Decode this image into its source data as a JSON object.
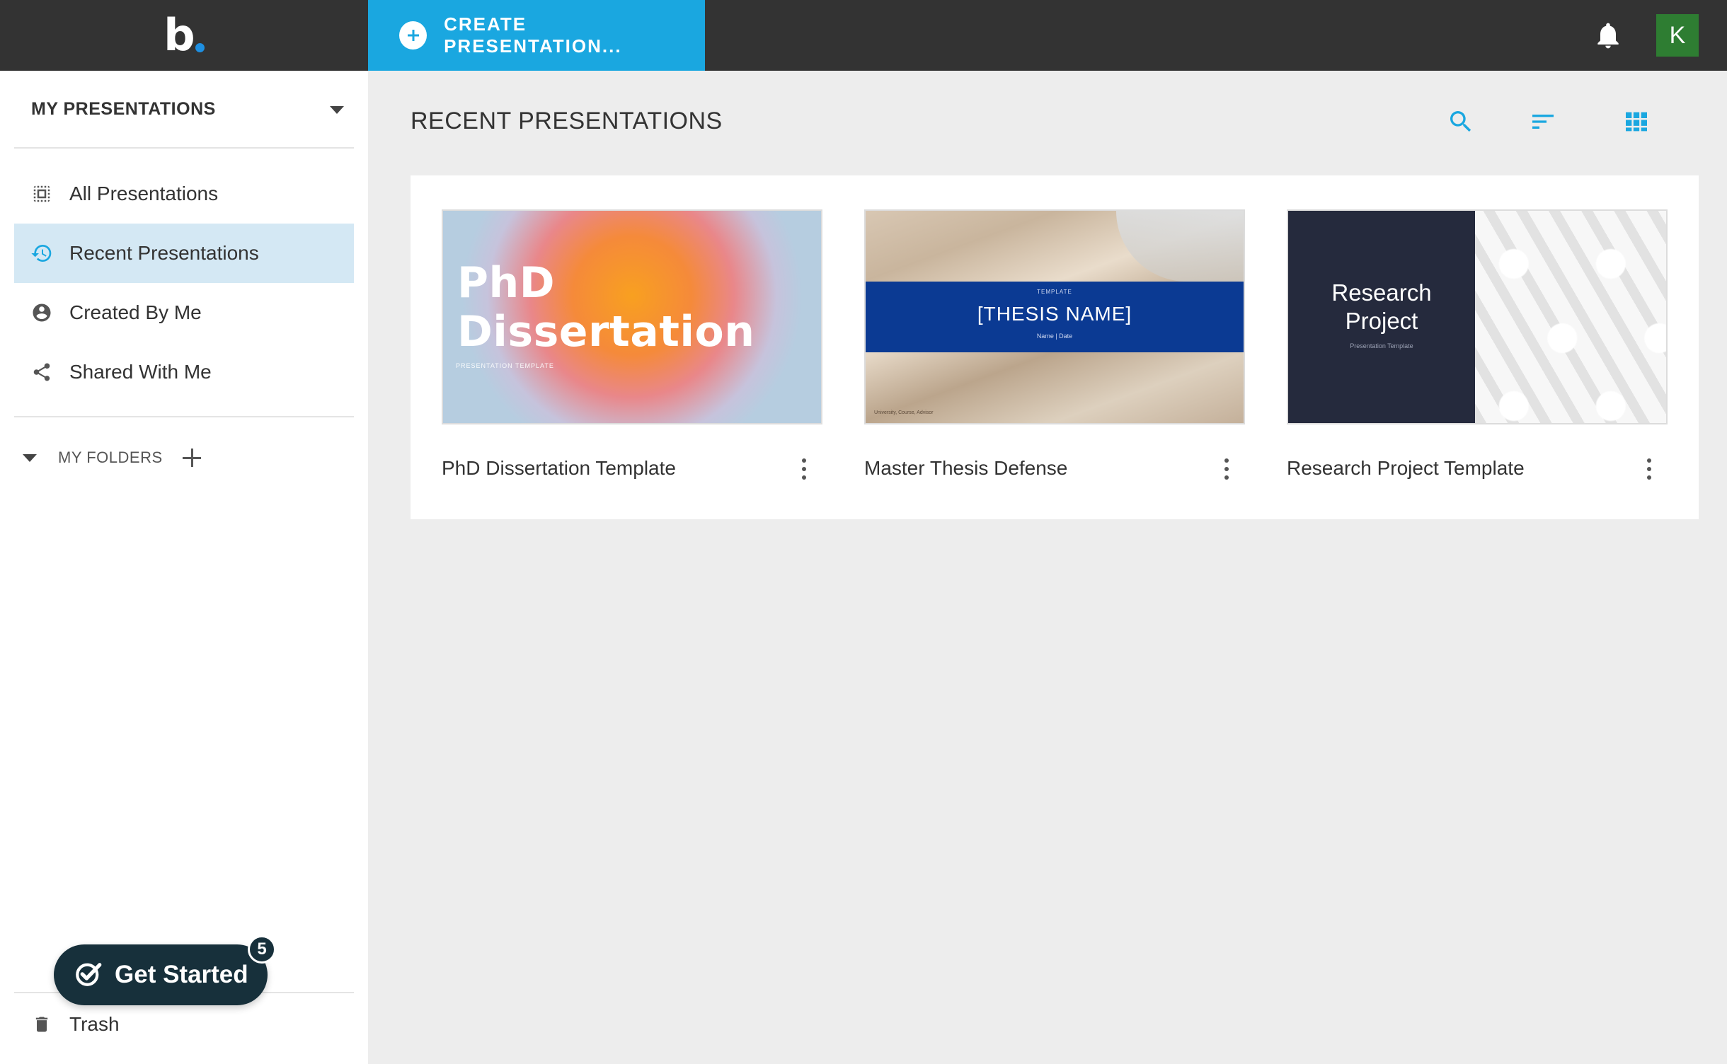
{
  "topbar": {
    "logo_letter": "b",
    "create_label": "CREATE PRESENTATION...",
    "avatar_initial": "K",
    "colors": {
      "bar": "#333333",
      "accent": "#1aa7e0",
      "avatar": "#2e7d32"
    }
  },
  "sidebar": {
    "header": "MY PRESENTATIONS",
    "items": [
      {
        "label": "All Presentations",
        "icon": "grid-select-icon"
      },
      {
        "label": "Recent Presentations",
        "icon": "history-icon",
        "active": true
      },
      {
        "label": "Created By Me",
        "icon": "person-icon"
      },
      {
        "label": "Shared With Me",
        "icon": "share-icon"
      }
    ],
    "folders_label": "MY FOLDERS",
    "trash_label": "Trash"
  },
  "get_started": {
    "label": "Get Started",
    "badge": "5"
  },
  "main": {
    "title": "RECENT PRESENTATIONS",
    "tools": [
      "search-icon",
      "sort-icon",
      "grid-view-icon"
    ],
    "cards": [
      {
        "title": "PhD Dissertation Template",
        "thumb": {
          "line1": "PhD",
          "line2": "Dissertation",
          "small": "PRESENTATION TEMPLATE"
        }
      },
      {
        "title": "Master Thesis Defense",
        "thumb": {
          "top": "TEMPLATE",
          "name": "[THESIS NAME]",
          "sub": "Name | Date",
          "foot": "University, Course, Advisor"
        }
      },
      {
        "title": "Research Project Template",
        "thumb": {
          "line1": "Research",
          "line2": "Project",
          "sub": "Presentation Template"
        }
      }
    ]
  }
}
